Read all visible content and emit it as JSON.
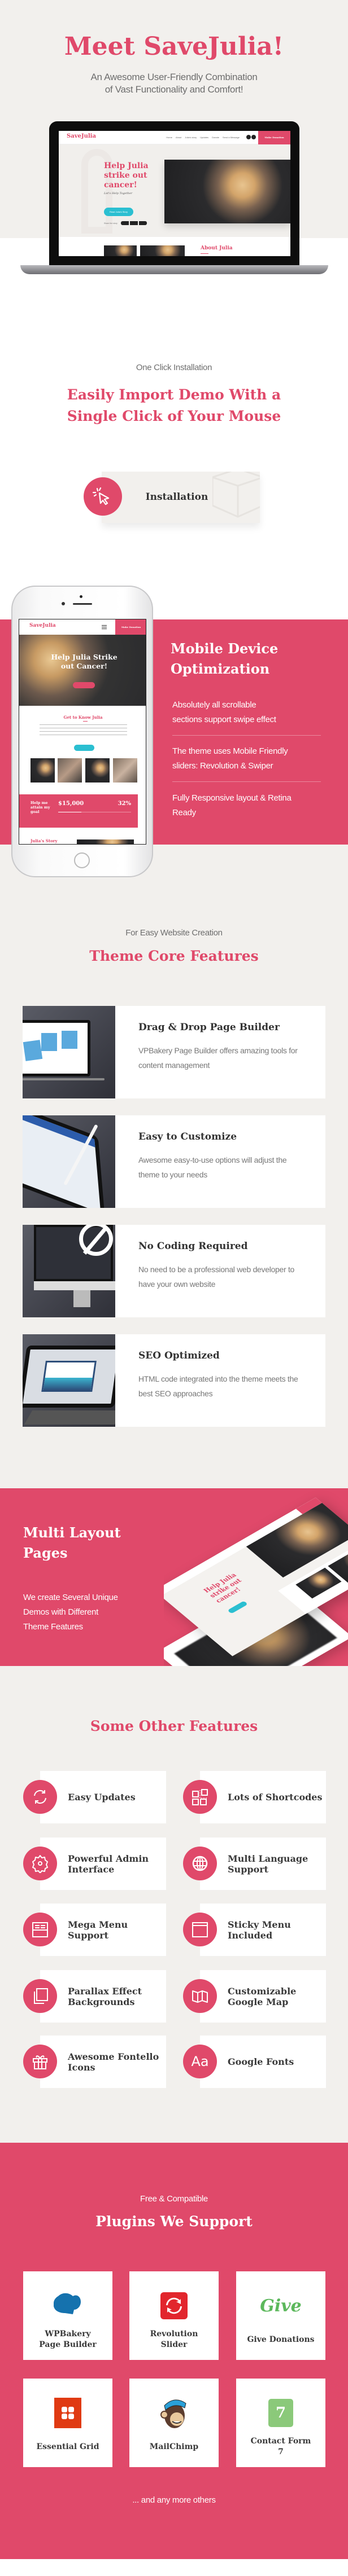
{
  "colors": {
    "accent": "#e0496a",
    "background": "#f2f0ed",
    "teal_button": "#2bbfd1"
  },
  "hero": {
    "title": "Meet SaveJulia!",
    "subtitle_line1": "An Awesome User-Friendly Combination",
    "subtitle_line2": "of Vast Functionality  and Comfort!"
  },
  "laptop_preview": {
    "logo": "SaveJulia",
    "nav": [
      "Home",
      "About",
      "Julia's story",
      "Updates",
      "Donate",
      "Send a Message"
    ],
    "donate_button": "Make Donation",
    "headline": [
      "Help Julia",
      "strike out",
      "cancer!"
    ],
    "script_text": "Let's Help Together",
    "cta": "Read Julia's Story",
    "share_label": "Share the story",
    "about_title": "About Julia"
  },
  "install": {
    "eyebrow": "One Click Installation",
    "title_line1": "Easily Import Demo With a",
    "title_line2": "Single Click of Your Mouse",
    "button_label": "Installation",
    "icon": "cursor-click-icon"
  },
  "mobile": {
    "title_line1": "Mobile Device",
    "title_line2": "Optimization",
    "items": [
      {
        "line1": "Absolutely all scrollable",
        "line2": "sections support swipe effect"
      },
      {
        "line1": "The theme uses Mobile Friendly",
        "line2": "sliders: Revolution & Swiper"
      },
      {
        "line1": "Fully Responsive layout & Retina",
        "line2": "Ready"
      }
    ],
    "preview": {
      "logo": "SaveJulia",
      "donate_button": "Make Donation",
      "headline1": "Help Julia Strike",
      "headline2": "out  Cancer!",
      "section_title": "Get to Know Julia",
      "goal_label": "Help me attain my goal",
      "goal_amount": "$15,000",
      "goal_percent": "32%",
      "goal_progress": 0.32,
      "story_title": "Julia's Story"
    }
  },
  "core": {
    "eyebrow": "For Easy Website Creation",
    "title": "Theme Core Features",
    "cards": [
      {
        "title": "Drag & Drop Page  Builder",
        "desc": "VPBakery Page Builder offers amazing tools for content management",
        "image": "laptop-page-builder"
      },
      {
        "title": "Easy to Customize",
        "desc": "Awesome easy-to-use options will adjust the theme to your needs",
        "image": "tablet-pencil"
      },
      {
        "title": "No Coding Required",
        "desc": "No need to be a professional web developer to have your own website",
        "image": "imac-no-code"
      },
      {
        "title": "SEO Optimized",
        "desc": "HTML code integrated into the theme meets the best SEO approaches",
        "image": "tablet-seo"
      }
    ]
  },
  "multi": {
    "title_line1": "Multi Layout",
    "title_line2": "Pages",
    "body": [
      "We create Several Unique",
      "Demos with Different",
      "Theme Features"
    ],
    "preview_headline": "Help Julia strike out cancer!"
  },
  "other": {
    "title": "Some Other Features",
    "items": [
      {
        "label": "Easy Updates",
        "icon": "refresh-icon"
      },
      {
        "label": "Lots of Shortcodes",
        "icon": "shortcodes-icon"
      },
      {
        "label": "Powerful Admin Interface",
        "icon": "gear-icon"
      },
      {
        "label": "Multi Language Support",
        "icon": "globe-icon"
      },
      {
        "label": "Mega Menu Support",
        "icon": "mega-menu-icon"
      },
      {
        "label": "Sticky Menu Included",
        "icon": "sticky-menu-icon"
      },
      {
        "label": "Parallax Effect Backgrounds",
        "icon": "layers-icon"
      },
      {
        "label": "Customizable Google Map",
        "icon": "map-icon"
      },
      {
        "label": "Awesome Fontello Icons",
        "icon": "gift-icon"
      },
      {
        "label": "Google Fonts",
        "icon": "font-icon",
        "icon_text": "Aa"
      }
    ]
  },
  "plugins": {
    "eyebrow": "Free & Compatible",
    "title": "Plugins We Support",
    "items": [
      {
        "label": "WPBakery Page Builder",
        "logo": "wpbakery-logo"
      },
      {
        "label": "Revolution Slider",
        "logo": "revolution-slider-logo"
      },
      {
        "label": "Give Donations",
        "logo": "give-logo",
        "logo_text": "Give"
      },
      {
        "label": "Essential Grid",
        "logo": "essential-grid-logo"
      },
      {
        "label": "MailChimp",
        "logo": "mailchimp-logo"
      },
      {
        "label": "Contact Form 7",
        "logo": "contact-form-7-logo",
        "logo_text": "7"
      }
    ],
    "footer": "... and any more others"
  }
}
